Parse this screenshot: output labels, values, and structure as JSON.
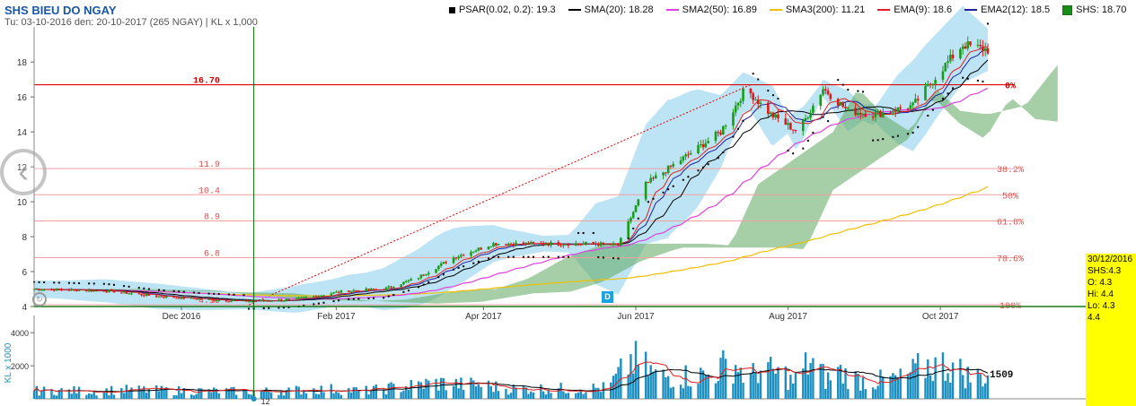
{
  "header": {
    "title": "SHS BIEU DO NGAY",
    "subtitle": "Tu: 03-10-2016 den: 20-10-2017 (265 NGAY) | KL x 1,000"
  },
  "legend": [
    {
      "label": "PSAR(0.02, 0.2): 19.3",
      "color": "#000000",
      "shape": "square"
    },
    {
      "label": "SMA(20): 18.28",
      "color": "#000000",
      "shape": "line"
    },
    {
      "label": "SMA2(50): 16.89",
      "color": "#e040e0",
      "shape": "line"
    },
    {
      "label": "SMA3(200): 11.21",
      "color": "#f0c000",
      "shape": "line"
    },
    {
      "label": "EMA(9): 18.6",
      "color": "#e02020",
      "shape": "line"
    },
    {
      "label": "EMA2(12): 18.5",
      "color": "#2020a0",
      "shape": "line"
    },
    {
      "label": "SHS: 18.70",
      "color": "#1a8c1a",
      "shape": "box"
    }
  ],
  "info_box": {
    "date": "30/12/2016",
    "symbol": "SHS:4.3",
    "open": "O: 4.3",
    "high": "Hi: 4.4",
    "low": "Lo: 4.3",
    "extra": "4.4"
  },
  "marker_label": "D",
  "colors": {
    "up": "#1a9c1a",
    "down": "#e01818",
    "volume": "#1b8fc0",
    "fib": "#e05050",
    "cloud": "#5ea85e",
    "band": "#87ceeb",
    "crosshair": "#006400"
  },
  "chart_data": {
    "type": "candlestick",
    "x_range": [
      "2016-10-03",
      "2017-10-20"
    ],
    "x_tick_labels": [
      "Dec 2016",
      "Feb 2017",
      "Apr 2017",
      "Jun 2017",
      "Aug 2017",
      "Oct 2017"
    ],
    "y_ticks": [
      4,
      6,
      8,
      10,
      12,
      14,
      16,
      18
    ],
    "ylim": [
      4,
      19.5
    ],
    "close_path": [
      [
        "2016-10-03",
        5.0
      ],
      [
        "2016-11-01",
        4.9
      ],
      [
        "2016-11-20",
        4.6
      ],
      [
        "2016-12-10",
        4.4
      ],
      [
        "2016-12-28",
        4.3
      ],
      [
        "2017-01-15",
        4.4
      ],
      [
        "2017-02-05",
        4.9
      ],
      [
        "2017-02-20",
        5.0
      ],
      [
        "2017-03-05",
        5.6
      ],
      [
        "2017-03-20",
        6.8
      ],
      [
        "2017-04-05",
        7.6
      ],
      [
        "2017-04-25",
        7.6
      ],
      [
        "2017-05-15",
        7.6
      ],
      [
        "2017-05-25",
        7.5
      ],
      [
        "2017-06-05",
        11.0
      ],
      [
        "2017-06-20",
        12.5
      ],
      [
        "2017-07-05",
        14.0
      ],
      [
        "2017-07-15",
        16.5
      ],
      [
        "2017-07-25",
        15.0
      ],
      [
        "2017-08-05",
        14.0
      ],
      [
        "2017-08-15",
        16.5
      ],
      [
        "2017-08-25",
        15.2
      ],
      [
        "2017-09-05",
        15.0
      ],
      [
        "2017-09-20",
        15.5
      ],
      [
        "2017-10-01",
        17.5
      ],
      [
        "2017-10-10",
        19.0
      ],
      [
        "2017-10-20",
        18.7
      ]
    ],
    "fib_levels": [
      {
        "price": 16.7,
        "label": "16.70",
        "pct": "0%"
      },
      {
        "price": 11.9,
        "label": "11.9",
        "pct": "38.2%"
      },
      {
        "price": 10.4,
        "label": "10.4",
        "pct": "50%"
      },
      {
        "price": 8.9,
        "label": "8.9",
        "pct": "61.8%"
      },
      {
        "price": 6.8,
        "label": "6.8",
        "pct": "78.6%"
      },
      {
        "price": 4.1,
        "label": "4.10",
        "pct": "100%"
      }
    ],
    "crosshair_date": "2016-12-30",
    "volume": {
      "y_ticks": [
        2000,
        4000
      ],
      "ylim": [
        0,
        4500
      ],
      "last_value": "1509",
      "ylabel": "KL x 1000",
      "crosshair_value": "12"
    }
  }
}
